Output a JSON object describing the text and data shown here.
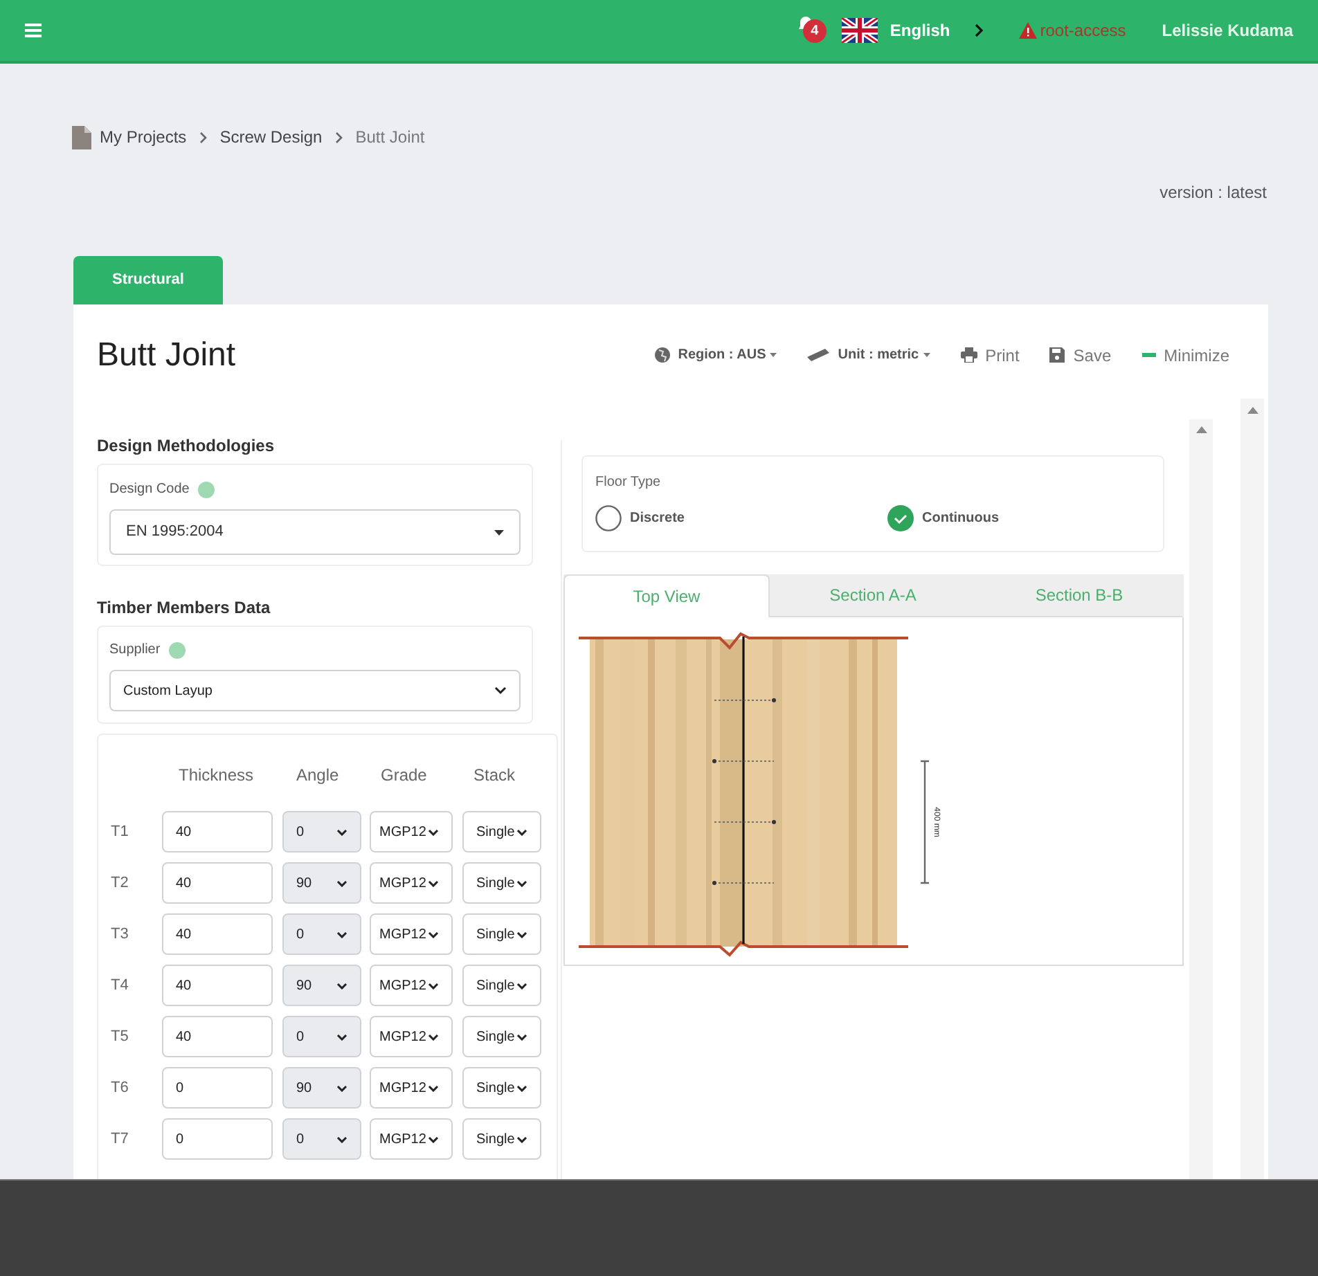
{
  "header": {
    "notifications": "4",
    "language": "English",
    "access": "root-access",
    "user": "Lelissie Kudama"
  },
  "breadcrumb": [
    "My Projects",
    "Screw Design",
    "Butt Joint"
  ],
  "version": "version : latest",
  "tabs": [
    {
      "label": "Structural",
      "selected": true
    }
  ],
  "title": "Butt Joint",
  "toolbar": [
    {
      "kind": "region",
      "label": "Region : AUS"
    },
    {
      "kind": "unit",
      "label": "Unit : metric"
    },
    {
      "kind": "print",
      "label": "Print"
    },
    {
      "kind": "save",
      "label": "Save"
    },
    {
      "kind": "minimize",
      "label": "Minimize"
    }
  ],
  "design_methodologies": {
    "heading": "Design Methodologies",
    "field_label": "Design Code",
    "value": "EN 1995:2004"
  },
  "timber_members": {
    "heading": "Timber Members Data",
    "field_label": "Supplier",
    "value": "Custom Layup",
    "columns": [
      "Thickness",
      "Angle",
      "Grade",
      "Stack"
    ],
    "rows": [
      {
        "label": "T1",
        "thickness": "40",
        "angle": "0",
        "grade": "MGP12",
        "stack": "Single"
      },
      {
        "label": "T2",
        "thickness": "40",
        "angle": "90",
        "grade": "MGP12",
        "stack": "Single"
      },
      {
        "label": "T3",
        "thickness": "40",
        "angle": "0",
        "grade": "MGP12",
        "stack": "Single"
      },
      {
        "label": "T4",
        "thickness": "40",
        "angle": "90",
        "grade": "MGP12",
        "stack": "Single"
      },
      {
        "label": "T5",
        "thickness": "40",
        "angle": "0",
        "grade": "MGP12",
        "stack": "Single"
      },
      {
        "label": "T6",
        "thickness": "0",
        "angle": "90",
        "grade": "MGP12",
        "stack": "Single"
      },
      {
        "label": "T7",
        "thickness": "0",
        "angle": "0",
        "grade": "MGP12",
        "stack": "Single"
      }
    ]
  },
  "floor_type": {
    "label": "Floor Type",
    "options": [
      {
        "label": "Discrete",
        "selected": false
      },
      {
        "label": "Continuous",
        "selected": true
      }
    ]
  },
  "view_tabs": [
    {
      "label": "Top View",
      "selected": true
    },
    {
      "label": "Section A-A",
      "selected": false
    },
    {
      "label": "Section B-B",
      "selected": false
    }
  ],
  "drawing": {
    "dimension": "400 mm"
  }
}
